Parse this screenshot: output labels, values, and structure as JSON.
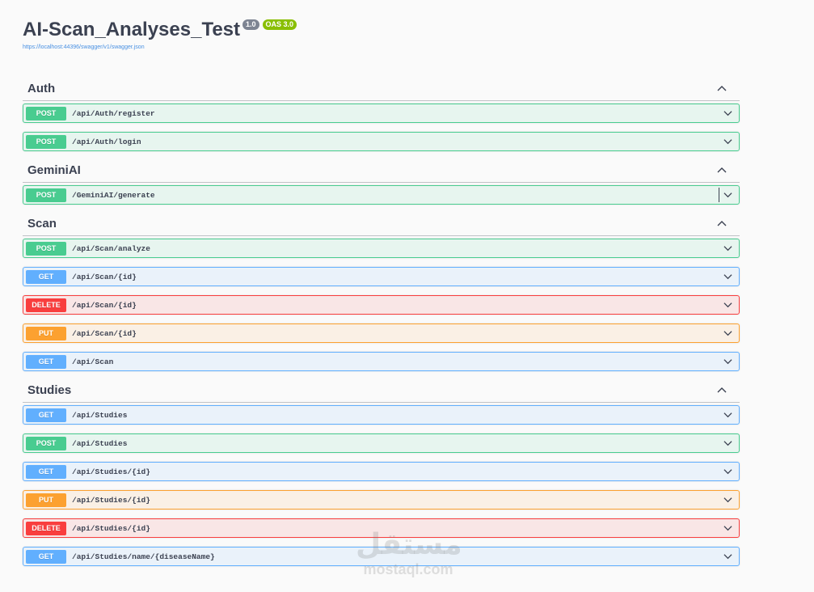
{
  "info": {
    "title": "AI-Scan_Analyses_Test",
    "version_badge": "1.0",
    "oas_badge": "OAS 3.0",
    "spec_url": "https://localhost:44396/swagger/v1/swagger.json"
  },
  "colors": {
    "post": "#49cc90",
    "get": "#61affe",
    "delete": "#f93e3e",
    "put": "#fca130"
  },
  "icons": {
    "collapse": "chevron-up-icon",
    "expand": "chevron-down-icon"
  },
  "tags": [
    {
      "name": "Auth",
      "operations": [
        {
          "method": "POST",
          "path": "/api/Auth/register"
        },
        {
          "method": "POST",
          "path": "/api/Auth/login"
        }
      ]
    },
    {
      "name": "GeminiAI",
      "operations": [
        {
          "method": "POST",
          "path": "/GeminiAI/generate"
        }
      ]
    },
    {
      "name": "Scan",
      "operations": [
        {
          "method": "POST",
          "path": "/api/Scan/analyze"
        },
        {
          "method": "GET",
          "path": "/api/Scan/{id}"
        },
        {
          "method": "DELETE",
          "path": "/api/Scan/{id}"
        },
        {
          "method": "PUT",
          "path": "/api/Scan/{id}"
        },
        {
          "method": "GET",
          "path": "/api/Scan"
        }
      ]
    },
    {
      "name": "Studies",
      "operations": [
        {
          "method": "GET",
          "path": "/api/Studies"
        },
        {
          "method": "POST",
          "path": "/api/Studies"
        },
        {
          "method": "GET",
          "path": "/api/Studies/{id}"
        },
        {
          "method": "PUT",
          "path": "/api/Studies/{id}"
        },
        {
          "method": "DELETE",
          "path": "/api/Studies/{id}"
        },
        {
          "method": "GET",
          "path": "/api/Studies/name/{diseaseName}"
        }
      ]
    }
  ],
  "watermark": {
    "arabic": "مستقل",
    "latin": "mostaql.com"
  }
}
